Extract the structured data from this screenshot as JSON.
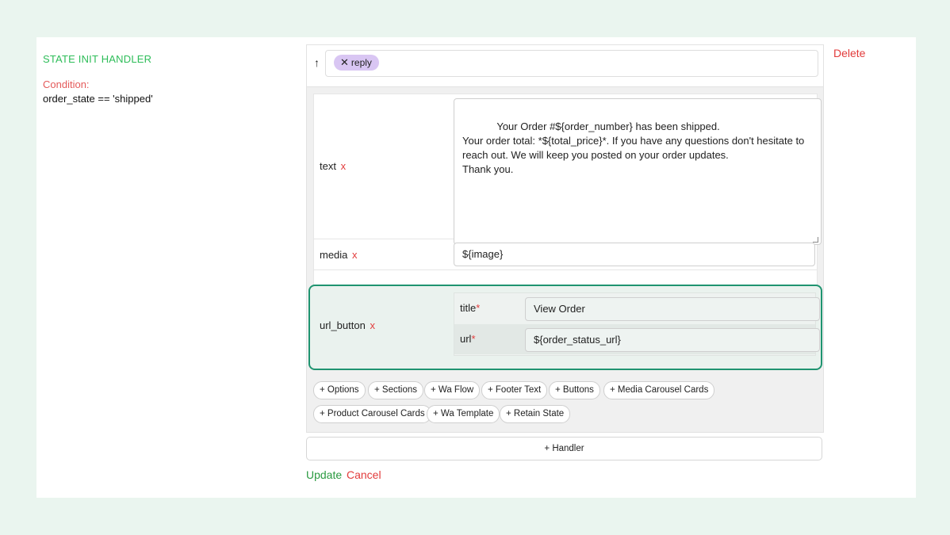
{
  "handler": {
    "state_title": "STATE INIT HANDLER",
    "condition_label": "Condition:",
    "condition_value": "order_state == 'shipped'"
  },
  "editor": {
    "arrow": "↑",
    "tags": [
      {
        "label": "reply",
        "remove": "✕"
      }
    ],
    "fields": {
      "text": {
        "label": "text",
        "remove": "x",
        "value": "Your Order #${order_number} has been shipped.\nYour order total: *${total_price}*. If you have any questions don't hesitate to reach out. We will keep you posted on your order updates.\nThank you."
      },
      "media": {
        "label": "media",
        "remove": "x",
        "value": "${image}"
      },
      "url_button": {
        "label": "url_button",
        "remove": "x",
        "title_label": "title",
        "title_value": "View Order",
        "url_label": "url",
        "url_value": "${order_status_url}",
        "required_mark": "*"
      }
    },
    "add_buttons_row1": [
      "+ Options",
      "+ Sections",
      "+ Wa Flow",
      "+ Footer Text",
      "+ Buttons",
      "+ Media Carousel Cards"
    ],
    "add_buttons_row2": [
      "+ Product Carousel Cards",
      "+ Wa Template",
      "+ Retain State"
    ]
  },
  "actions": {
    "handler": "+ Handler",
    "update": "Update",
    "cancel": "Cancel",
    "delete": "Delete"
  },
  "colors": {
    "accent_green": "#2ebd59",
    "highlight_border": "#1f9470",
    "danger": "#e23b3b",
    "chip_bg": "#d9c6f3"
  }
}
